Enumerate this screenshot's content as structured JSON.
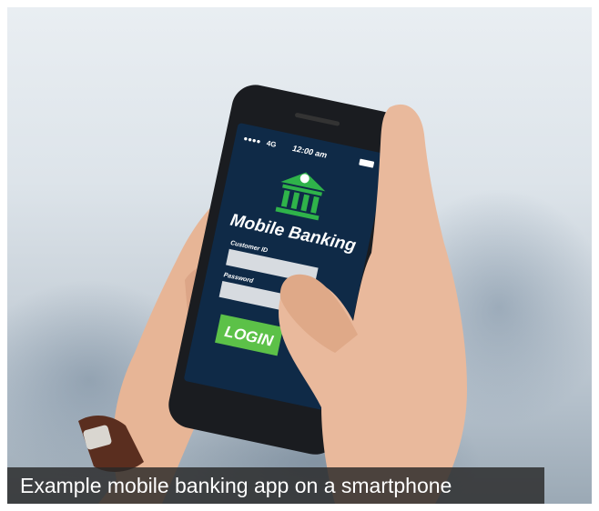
{
  "phone_screen": {
    "status_time": "12:00 am",
    "status_network": "4G",
    "app_title": "Mobile Banking",
    "customer_id_label": "Customer ID",
    "password_label": "Password",
    "login_button": "LOGIN"
  },
  "caption": "Example mobile banking app on a smartphone",
  "colors": {
    "screen_bg": "#0f2a47",
    "accent_green": "#2fb34a",
    "login_green": "#5cc148",
    "caption_bg": "#2b2b2b"
  }
}
